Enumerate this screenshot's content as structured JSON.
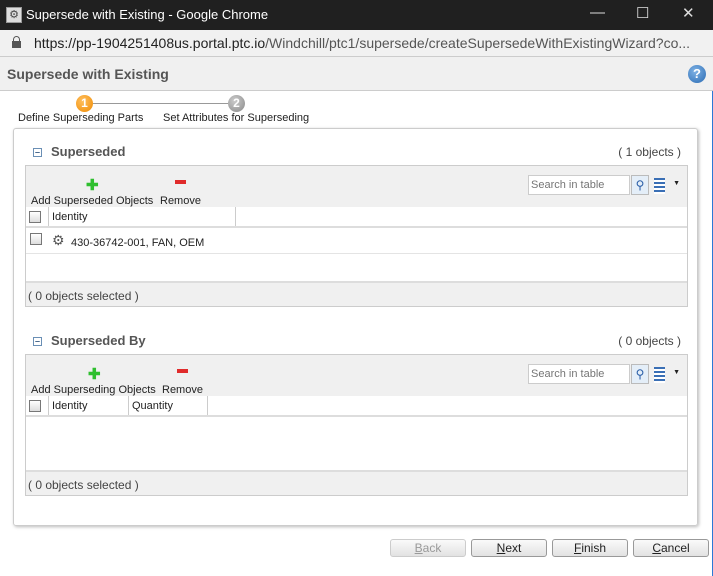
{
  "window": {
    "title": "Supersede with Existing - Google Chrome",
    "url_host": "https://pp-1904251408us.portal.ptc.io",
    "url_path": "/Windchill/ptc1/supersede/createSupersedeWithExistingWizard?co..."
  },
  "header": {
    "title": "Supersede with Existing",
    "help": "?"
  },
  "steps": [
    {
      "num": "1",
      "label": "Define Superseding Parts"
    },
    {
      "num": "2",
      "label": "Set Attributes for Superseding"
    }
  ],
  "superseded": {
    "title": "Superseded",
    "count": "( 1 objects )",
    "add": "Add Superseded Objects",
    "remove": "Remove",
    "search_placeholder": "Search in table",
    "columns": [
      "Identity"
    ],
    "rows": [
      {
        "identity": "430-36742-001, FAN, OEM"
      }
    ],
    "footer": "( 0 objects selected )"
  },
  "superseded_by": {
    "title": "Superseded By",
    "count": "( 0 objects )",
    "add": "Add Superseding Objects",
    "remove": "Remove",
    "search_placeholder": "Search in table",
    "columns": [
      "Identity",
      "Quantity"
    ],
    "footer": "( 0 objects selected )"
  },
  "buttons": {
    "back_u": "B",
    "back": "ack",
    "next_u": "N",
    "next": "ext",
    "finish_u": "F",
    "finish": "inish",
    "cancel_u": "C",
    "cancel": "ancel"
  }
}
